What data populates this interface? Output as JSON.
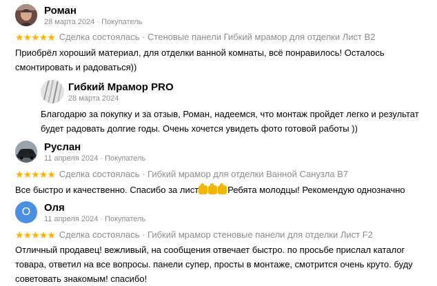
{
  "reviews": [
    {
      "name": "Роман",
      "meta": "28 марта 2024 · Покупатель",
      "stars": "★★★★★",
      "deal": "Сделка состоялась · Стеновые панели Гибкий мрамор для отделки Лист В2",
      "text_lines": [
        "Приобрёл хороший материал, для отделки ванной комнаты, всё понравилось! Осталось",
        "смонтировать и радоваться))"
      ],
      "reply": {
        "name": "Гибкий Мрамор PRO",
        "meta": "28 марта 2024",
        "text_lines": [
          "Благодарю за покупку и за отзыв, Роман, надеемся, что монтаж пройдет легко и результат",
          "будет радовать долгие годы. Очень хочется увидеть фото готовой работы ))"
        ]
      }
    },
    {
      "name": "Руслан",
      "meta": "11 апреля 2024 · Покупатель",
      "stars": "★★★★★",
      "deal": "Сделка состоялась · Гибкий мрамор для отделки Ванной Санузла В7",
      "text_before": "Все быстро и качественно. Спасибо за лист",
      "text_after": "Ребята молодцы! Рекомендую однозначно"
    },
    {
      "name": "Оля",
      "avatar_letter": "О",
      "meta": "11 апреля 2024 · Покупатель",
      "stars": "★★★★★",
      "deal": "Сделка состоялась · Гибкий мрамор стеновые панели для отделки Лист F2",
      "text_lines": [
        "Отличный продавец! вежливый, на сообщения отвечает быстро. по просьбе прислал каталог",
        "товара, ответил на все вопросы. панели супер, просты в монтаже, смотрится очень круто. буду",
        "советовать знакомым! спасибо!"
      ]
    }
  ],
  "colors": {
    "star": "#ffb300",
    "meta_text": "#8c8c8c",
    "avatar_blue": "#4a90e2"
  },
  "icons": [
    "user-photo-avatar",
    "marble-logo-avatar",
    "car-photo-avatar",
    "thumbs-up-emoji"
  ]
}
